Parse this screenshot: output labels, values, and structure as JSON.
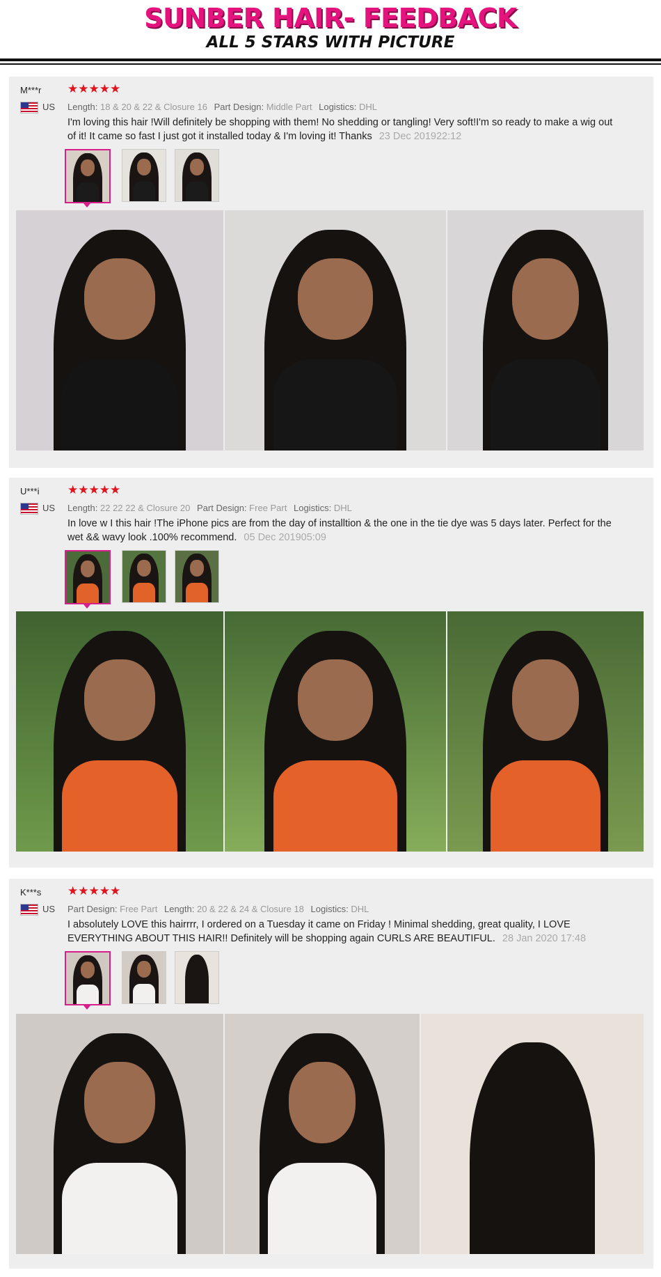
{
  "header": {
    "title": "SUNBER HAIR- FEEDBACK",
    "subtitle": "ALL 5 STARS WITH PICTURE"
  },
  "colors": {
    "brand_pink": "#e5137d",
    "star_red": "#e0141e",
    "selected_border": "#d81e8a",
    "card_bg": "#eeeeee"
  },
  "reviews": [
    {
      "user": "M***r",
      "country": "US",
      "stars": "★★★★★",
      "rating": 5,
      "meta": [
        {
          "key": "Length:",
          "value": "18 & 20 & 22 & Closure 16"
        },
        {
          "key": "Part Design:",
          "value": "Middle Part"
        },
        {
          "key": "Logistics:",
          "value": "DHL"
        }
      ],
      "text": "I'm loving this hair !Will definitely be shopping with them! No shedding or tangling! Very soft!I'm so ready to make a wig out of it! It came so fast I just got it installed today & I'm loving it! Thanks",
      "date": "23 Dec 201922:12",
      "thumbnails": [
        "review-photo-1",
        "review-photo-2",
        "review-photo-3"
      ],
      "selected_thumbnail": 1,
      "photos": [
        "customer-photo-1",
        "customer-photo-2",
        "customer-photo-3"
      ]
    },
    {
      "user": "U***i",
      "country": "US",
      "stars": "★★★★★",
      "rating": 5,
      "meta": [
        {
          "key": "Length:",
          "value": "22 22 22 & Closure 20"
        },
        {
          "key": "Part Design:",
          "value": "Free Part"
        },
        {
          "key": "Logistics:",
          "value": "DHL"
        }
      ],
      "text": "In love w I this hair !The iPhone pics are from the day of installtion & the one in the tie dye was 5 days later. Perfect for the wet && wavy look .100% recommend.",
      "date": "05 Dec 201905:09",
      "thumbnails": [
        "review-photo-1",
        "review-photo-2",
        "review-photo-3"
      ],
      "selected_thumbnail": 1,
      "photos": [
        "customer-photo-1",
        "customer-photo-2",
        "customer-photo-3"
      ]
    },
    {
      "user": "K***s",
      "country": "US",
      "stars": "★★★★★",
      "rating": 5,
      "meta": [
        {
          "key": "Part Design:",
          "value": "Free Part"
        },
        {
          "key": "Length:",
          "value": "20 & 22 & 24 & Closure 18"
        },
        {
          "key": "Logistics:",
          "value": "DHL"
        }
      ],
      "text": "I absolutely LOVE this hairrrr, I ordered on a Tuesday it came on Friday ! Minimal shedding, great quality, I LOVE EVERYTHING  ABOUT THIS HAIR!! Definitely will be shopping again CURLS ARE BEAUTIFUL.",
      "date": "28 Jan 2020 17:48",
      "thumbnails": [
        "review-photo-1",
        "review-photo-2",
        "review-photo-3"
      ],
      "selected_thumbnail": 1,
      "photos": [
        "customer-photo-1",
        "customer-photo-2",
        "customer-photo-3"
      ]
    }
  ]
}
